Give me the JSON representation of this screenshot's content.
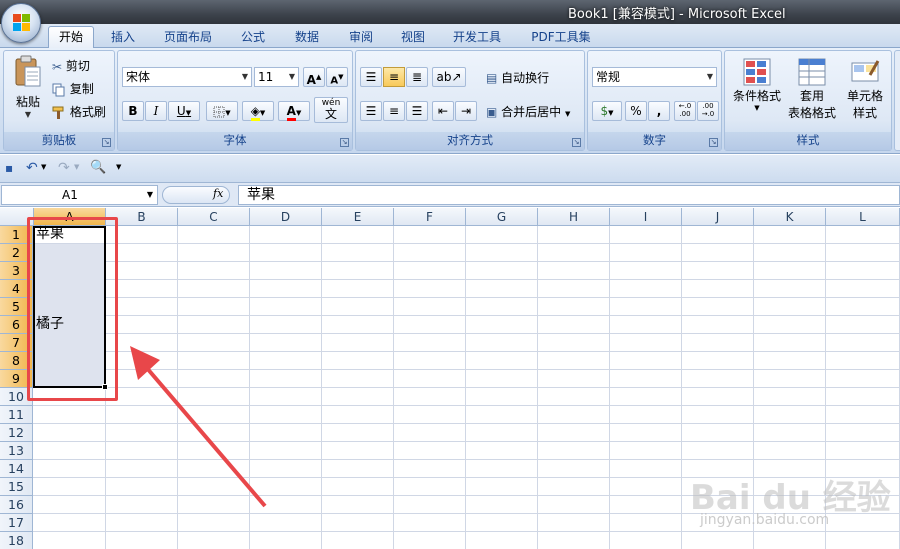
{
  "window": {
    "title": "Book1  [兼容模式] - Microsoft Excel"
  },
  "tabs": [
    "开始",
    "插入",
    "页面布局",
    "公式",
    "数据",
    "审阅",
    "视图",
    "开发工具",
    "PDF工具集"
  ],
  "active_tab": "开始",
  "clipboard": {
    "paste": "粘贴",
    "cut": "剪切",
    "copy": "复制",
    "format_painter": "格式刷",
    "label": "剪贴板"
  },
  "font": {
    "name": "宋体",
    "size": "11",
    "label": "字体",
    "bold": "B",
    "italic": "I",
    "underline": "U",
    "font_color_icon": "A",
    "wen": "wén",
    "wen_char": "文"
  },
  "alignment": {
    "wrap": "自动换行",
    "merge": "合并后居中",
    "label": "对齐方式"
  },
  "number": {
    "format": "常规",
    "percent": "%",
    "comma": ",",
    "inc_decimal_top": "←.0",
    "inc_decimal_bottom": ".00",
    "dec_decimal_top": ".00",
    "dec_decimal_bottom": "→.0",
    "label": "数字"
  },
  "styles": {
    "conditional": "条件格式",
    "table_line1": "套用",
    "table_line2": "表格格式",
    "cell_line1": "单元格",
    "cell_line2": "样式",
    "label": "样式"
  },
  "formula_bar": {
    "name_box": "A1",
    "fx": "fx",
    "content": "苹果"
  },
  "columns": [
    "A",
    "B",
    "C",
    "D",
    "E",
    "F",
    "G",
    "H",
    "I",
    "J",
    "K",
    "L"
  ],
  "rows": [
    "1",
    "2",
    "3",
    "4",
    "5",
    "6",
    "7",
    "8",
    "9",
    "10",
    "11",
    "12",
    "13",
    "14",
    "15",
    "16",
    "17",
    "18"
  ],
  "cells": {
    "A1": "苹果",
    "A6": "橘子"
  },
  "selection": "A1:A9",
  "watermark": {
    "logo": "Bai du 经验",
    "url": "jingyan.baidu.com"
  },
  "colors": {
    "annotation": "#e8474a",
    "selection_fill": "#dee3ee",
    "ribbon_text": "#15428b"
  }
}
